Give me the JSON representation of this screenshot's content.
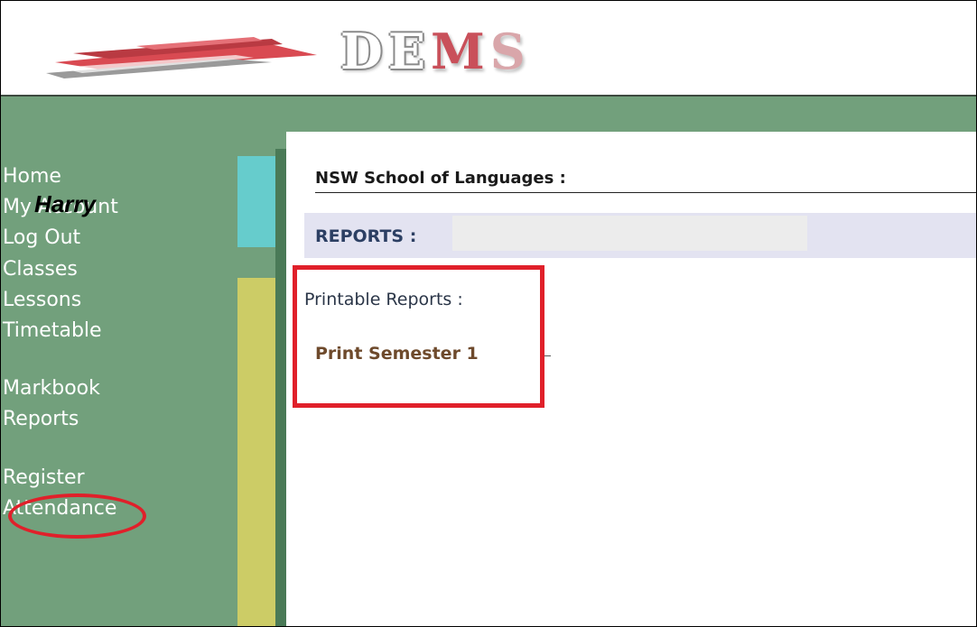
{
  "header": {
    "logo_letters": [
      "D",
      "E",
      "M",
      "S"
    ],
    "logo_colors": {
      "outline": "#8a8a8a",
      "m": "#c9505a",
      "s": "#d9a6aa",
      "wing_red": "#d94a52",
      "wing_grey": "#9a9a9a"
    }
  },
  "sidebar": {
    "groups": [
      {
        "items": [
          {
            "label": "Home"
          },
          {
            "label": "My Account"
          },
          {
            "label": "Log Out"
          }
        ]
      },
      {
        "items": [
          {
            "label": "Classes"
          },
          {
            "label": "Lessons"
          },
          {
            "label": "Timetable"
          }
        ]
      },
      {
        "items": [
          {
            "label": "Markbook"
          },
          {
            "label": "Reports"
          }
        ]
      },
      {
        "items": [
          {
            "label": "Register"
          },
          {
            "label": "Attendance"
          }
        ]
      }
    ],
    "user_name": "Harry",
    "active_item": "Reports"
  },
  "main": {
    "school_title": "NSW School of Languages :",
    "section_title": "REPORTS :",
    "printable_label": "Printable Reports :",
    "print_link_label": "Print Semester 1"
  },
  "colors": {
    "page_green": "#72a07c",
    "sidebar_dark": "#4a7a57",
    "bar_cyan": "#66cccc",
    "bar_yellow": "#cccc66",
    "section_band": "#e3e3f1",
    "annotation_red": "#e0202a",
    "link_brown": "#6e4a2c"
  }
}
